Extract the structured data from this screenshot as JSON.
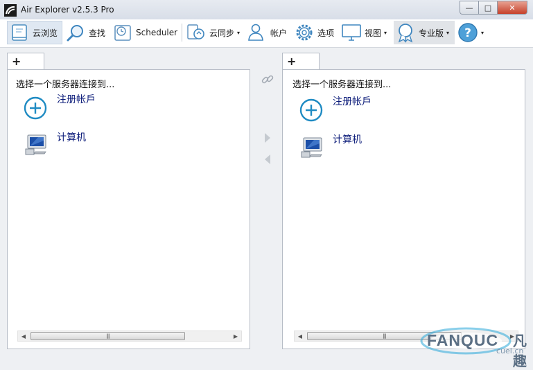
{
  "window": {
    "title": "Air Explorer v2.5.3 Pro",
    "minimize_glyph": "—",
    "maximize_glyph": "□",
    "close_glyph": "✕"
  },
  "toolbar": {
    "cloud_browse": "云浏览",
    "search": "查找",
    "scheduler": "Scheduler",
    "cloud_sync": "云同步",
    "accounts": "帐户",
    "options": "选项",
    "view": "视图",
    "pro": "专业版",
    "dropdown_glyph": "▾"
  },
  "left_pane": {
    "tab_label": "+",
    "prompt": "选择一个服务器连接到...",
    "items": [
      {
        "label": "注册帐戶",
        "icon": "add-circle-icon"
      },
      {
        "label": "计算机",
        "icon": "computer-icon"
      }
    ],
    "scroll_left": "◀",
    "scroll_right": "▶",
    "scroll_grip": "|||"
  },
  "right_pane": {
    "tab_label": "+",
    "prompt": "选择一个服务器连接到...",
    "items": [
      {
        "label": "注册帐戶",
        "icon": "add-circle-icon"
      },
      {
        "label": "计算机",
        "icon": "computer-icon"
      }
    ],
    "scroll_left": "◀",
    "scroll_right": "▶",
    "scroll_grip": "|||"
  },
  "watermark": {
    "brand": "FANQUC",
    "brand_cn": "凡趣",
    "url": "cuel.cn"
  },
  "colors": {
    "accent": "#1f8bc3",
    "item_label": "#0c1c7a",
    "close_button": "#c6402a"
  }
}
